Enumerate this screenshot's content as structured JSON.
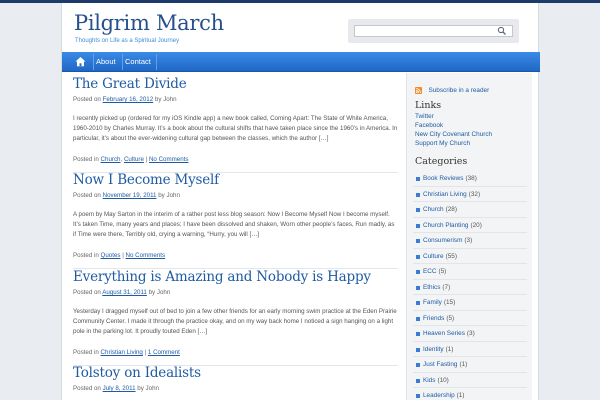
{
  "header": {
    "site_title": "Pilgrim March",
    "tagline": "Thoughts on Life as a Spiritual Journey",
    "search_value": ""
  },
  "nav": {
    "items": [
      {
        "label": "About"
      },
      {
        "label": "Contact"
      }
    ]
  },
  "posts": [
    {
      "title": "The Great Divide",
      "meta_prefix": "Posted on",
      "date": "February 16, 2012",
      "author_prefix": "by",
      "author": "John",
      "excerpt": "I recently picked up (ordered for my iOS Kindle app) a new book called, Coming Apart: The State of White America, 1960-2010 by Charles Murray. It’s a book about the cultural shifts that have taken place since the 1960’s in America. In particular, it’s about the ever-widening cultural gap between the classes, which the author […]",
      "foot_prefix": "Posted in",
      "categories": [
        "Church",
        "Culture"
      ],
      "comments": "No Comments"
    },
    {
      "title": "Now I Become Myself",
      "meta_prefix": "Posted on",
      "date": "November 19, 2011",
      "author_prefix": "by",
      "author": "John",
      "excerpt": "A poem by May Sarton in the interim of a rather post less blog season: Now I Become Myself Now I become myself. It’s taken Time, many years and places; I have been dissolved and shaken, Worn other people’s faces, Run madly, as if Time were there, Terribly old, crying a warning, “Hurry, you will […]",
      "foot_prefix": "Posted in",
      "categories": [
        "Quotes"
      ],
      "comments": "No Comments"
    },
    {
      "title": "Everything is Amazing and Nobody is Happy",
      "meta_prefix": "Posted on",
      "date": "August 31, 2011",
      "author_prefix": "by",
      "author": "John",
      "excerpt": "Yesterday I dragged myself out of bed to join a few other friends for an early morning swim practice at the Eden Prairie Community Center.  I made it through the practice okay, and on my way back home I noticed a sign hanging on a light pole in the parking lot.  It proudly touted Eden […]",
      "foot_prefix": "Posted in",
      "categories": [
        "Christian Living"
      ],
      "comments": "1 Comment"
    },
    {
      "title": "Tolstoy on Idealists",
      "meta_prefix": "Posted on",
      "date": "July 8, 2011",
      "author_prefix": "by",
      "author": "John"
    }
  ],
  "sidebar": {
    "rss_label": "Subscribe in a reader",
    "links_heading": "Links",
    "links": [
      "Twitter",
      "Facebook",
      "New City Covenant Church",
      "Support My Church"
    ],
    "categories_heading": "Categories",
    "categories": [
      {
        "name": "Book Reviews",
        "count": "(38)"
      },
      {
        "name": "Christian Living",
        "count": "(32)"
      },
      {
        "name": "Church",
        "count": "(28)"
      },
      {
        "name": "Church Planting",
        "count": "(20)"
      },
      {
        "name": "Consumerism",
        "count": "(3)"
      },
      {
        "name": "Culture",
        "count": "(55)"
      },
      {
        "name": "ECC",
        "count": "(5)"
      },
      {
        "name": "Ethics",
        "count": "(7)"
      },
      {
        "name": "Family",
        "count": "(15)"
      },
      {
        "name": "Friends",
        "count": "(5)"
      },
      {
        "name": "Heaven Series",
        "count": "(3)"
      },
      {
        "name": "Identity",
        "count": "(1)"
      },
      {
        "name": "Just Fasting",
        "count": "(1)"
      },
      {
        "name": "Kids",
        "count": "(10)"
      },
      {
        "name": "Leadership",
        "count": "(1)"
      }
    ]
  }
}
